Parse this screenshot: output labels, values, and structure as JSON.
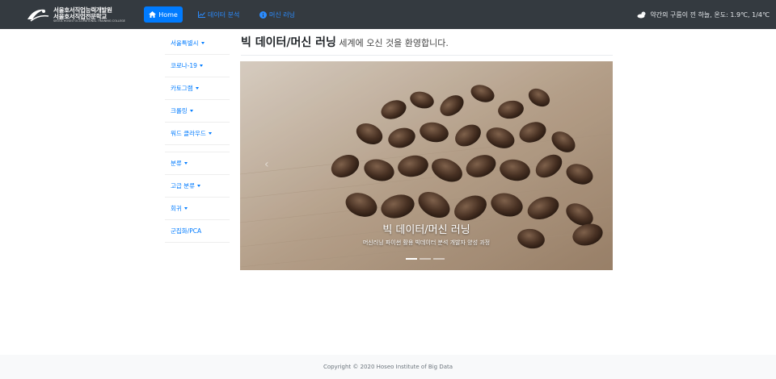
{
  "header": {
    "logo": {
      "line1": "서울호서직업능력개발원",
      "line2": "서울호서직업전문학교",
      "line3": "SEOUL HOSEO OCCUPATIONAL TRAINING COLLEGE"
    },
    "nav": [
      {
        "label": "Home",
        "icon": "home-icon",
        "active": true
      },
      {
        "label": "데이터 분석",
        "icon": "chart-icon",
        "active": false
      },
      {
        "label": "머신 러닝",
        "icon": "info-circle-icon",
        "active": false
      }
    ],
    "weather": {
      "icon": "cloud-sun-icon",
      "text": "약간의 구름이 낀 하늘, 온도: 1.9℃, 1/4℃"
    }
  },
  "sidebar": {
    "items": [
      {
        "label": "서울특별시",
        "dropdown": true
      },
      {
        "label": "코로나-19",
        "dropdown": true
      },
      {
        "label": "카토그램",
        "dropdown": true
      },
      {
        "label": "크롤링",
        "dropdown": true
      },
      {
        "label": "워드 클라우드",
        "dropdown": true
      },
      {
        "label": "분류",
        "dropdown": true
      },
      {
        "label": "고급 분류",
        "dropdown": true
      },
      {
        "label": "회귀",
        "dropdown": true
      },
      {
        "label": "군집화/PCA",
        "dropdown": false
      }
    ]
  },
  "main": {
    "title_bold": "빅 데이터/머신 러닝",
    "title_rest": " 세계에 오신 것을 환영합니다."
  },
  "carousel": {
    "caption": "빅 데이터/머신 러닝",
    "subcaption": "머신러닝 파이썬 활용 빅데이터 분석 개발자 양성 과정",
    "indicators": 3,
    "active_index": 0
  },
  "footer": {
    "text": "Copyright © 2020 Hoseo Institute of Big Data"
  },
  "colors": {
    "navbar": "#343a40",
    "primary": "#007bff",
    "footer_bg": "#f8f9fa"
  }
}
